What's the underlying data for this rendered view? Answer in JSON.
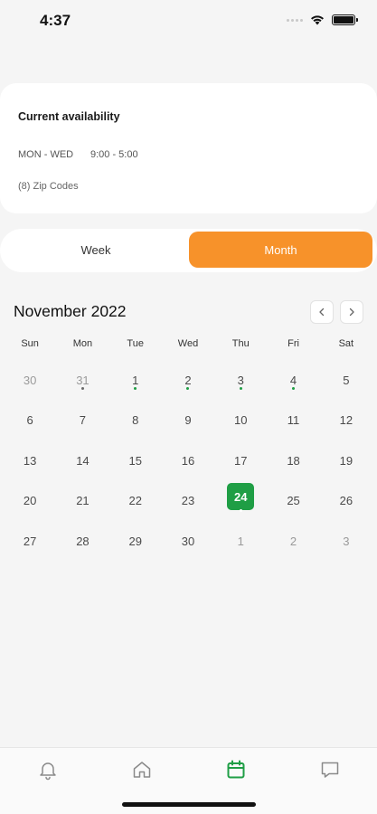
{
  "status_bar": {
    "time": "4:37"
  },
  "availability": {
    "title": "Current availability",
    "days": "MON - WED",
    "hours": "9:00 - 5:00",
    "zip_codes": "(8) Zip Codes"
  },
  "view_toggle": {
    "week_label": "Week",
    "month_label": "Month",
    "selected": "Month"
  },
  "calendar": {
    "month_title": "November 2022",
    "weekdays": [
      "Sun",
      "Mon",
      "Tue",
      "Wed",
      "Thu",
      "Fri",
      "Sat"
    ],
    "weeks": [
      [
        "30",
        "31",
        "1",
        "2",
        "3",
        "4",
        "5"
      ],
      [
        "6",
        "7",
        "8",
        "9",
        "10",
        "11",
        "12"
      ],
      [
        "13",
        "14",
        "15",
        "16",
        "17",
        "18",
        "19"
      ],
      [
        "20",
        "21",
        "22",
        "23",
        "24",
        "25",
        "26"
      ],
      [
        "27",
        "28",
        "29",
        "30",
        "1",
        "2",
        "3"
      ]
    ],
    "selected_date": "24"
  },
  "tab_bar": {
    "tabs": [
      "bell-icon",
      "home-icon",
      "calendar-icon",
      "chat-icon"
    ],
    "active_tab": "calendar-icon"
  },
  "colors": {
    "accent_orange": "#f7922a",
    "accent_green": "#1f9e45",
    "background": "#f5f5f5"
  }
}
